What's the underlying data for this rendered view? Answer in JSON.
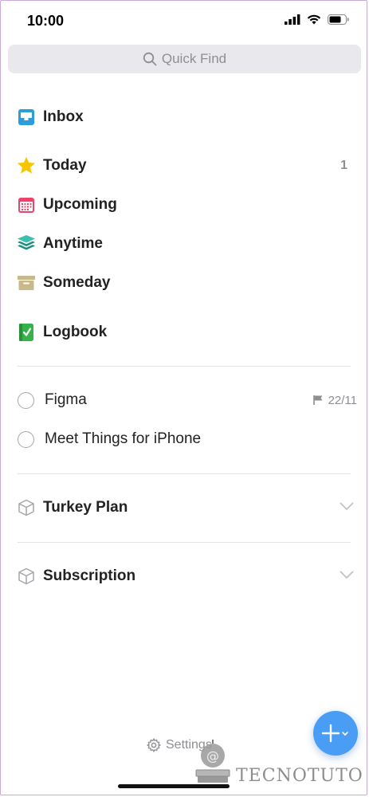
{
  "status_bar": {
    "time": "10:00"
  },
  "search": {
    "placeholder": "Quick Find"
  },
  "nav": {
    "inbox": "Inbox",
    "today": "Today",
    "today_count": "1",
    "upcoming": "Upcoming",
    "anytime": "Anytime",
    "someday": "Someday",
    "logbook": "Logbook"
  },
  "todos": [
    {
      "label": "Figma",
      "due": "22/11"
    },
    {
      "label": "Meet Things for iPhone"
    }
  ],
  "areas": [
    {
      "label": "Turkey Plan"
    },
    {
      "label": "Subscription"
    }
  ],
  "footer": {
    "settings": "Settings"
  },
  "watermark": {
    "text": "TECNOTUTO"
  },
  "colors": {
    "inbox": "#2d9cdb",
    "today": "#f7c600",
    "upcoming": "#e8456b",
    "anytime": "#27a89a",
    "someday": "#c8b98a",
    "logbook": "#36b24a",
    "fab": "#4a9df4"
  },
  "icons": {
    "inbox": "inbox-tray-icon",
    "today": "star-icon",
    "upcoming": "calendar-icon",
    "anytime": "layers-icon",
    "someday": "archive-box-icon",
    "logbook": "checkbook-icon",
    "area": "cube-icon",
    "settings": "gear-icon",
    "deadline": "flag-icon"
  }
}
